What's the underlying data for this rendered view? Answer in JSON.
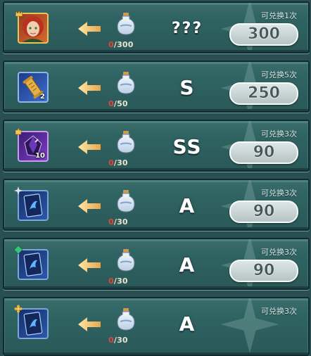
{
  "rows": [
    {
      "item": {
        "icon": "hero-portrait-icon",
        "count": ""
      },
      "progress": {
        "current": "0",
        "max": "300"
      },
      "grade": "???",
      "limit": "可兑换1次",
      "price": "300"
    },
    {
      "item": {
        "icon": "golden-scroll-icon",
        "count": "2"
      },
      "progress": {
        "current": "0",
        "max": "50"
      },
      "grade": "S",
      "limit": "可兑换5次",
      "price": "250"
    },
    {
      "item": {
        "icon": "purple-crystal-icon",
        "count": "10"
      },
      "progress": {
        "current": "0",
        "max": "30"
      },
      "grade": "SS",
      "limit": "可兑换3次",
      "price": "90"
    },
    {
      "item": {
        "icon": "blue-card-icon",
        "count": ""
      },
      "progress": {
        "current": "0",
        "max": "30"
      },
      "grade": "A",
      "limit": "可兑换3次",
      "price": "90"
    },
    {
      "item": {
        "icon": "blue-card-icon",
        "count": ""
      },
      "progress": {
        "current": "0",
        "max": "30"
      },
      "grade": "A",
      "limit": "可兑换3次",
      "price": "90"
    },
    {
      "item": {
        "icon": "blue-card-icon",
        "count": ""
      },
      "progress": {
        "current": "0",
        "max": "30"
      },
      "grade": "A",
      "limit": "可兑换3次",
      "price": ""
    }
  ],
  "colors": {
    "row_bg": "#2f6463",
    "progress_current": "#e2453a",
    "price_button": "#cfdada",
    "arrow": "#f1c36a"
  }
}
